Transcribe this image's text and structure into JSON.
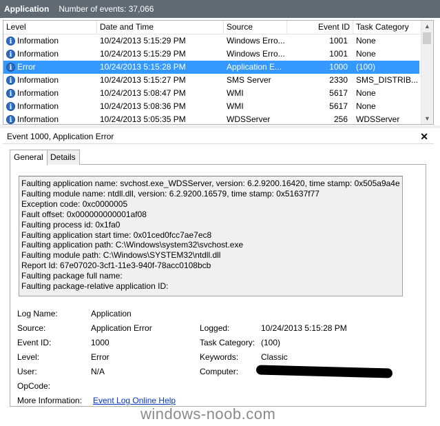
{
  "window": {
    "title": "Application",
    "count_text": "Number of events: 37,066"
  },
  "columns": [
    "Level",
    "Date and Time",
    "Source",
    "Event ID",
    "Task Category"
  ],
  "events": [
    {
      "level": "Information",
      "date": "10/24/2013 5:15:29 PM",
      "source": "Windows Erro...",
      "id": "1001",
      "task": "None",
      "selected": false
    },
    {
      "level": "Information",
      "date": "10/24/2013 5:15:29 PM",
      "source": "Windows Erro...",
      "id": "1001",
      "task": "None",
      "selected": false
    },
    {
      "level": "Error",
      "date": "10/24/2013 5:15:28 PM",
      "source": "Application E...",
      "id": "1000",
      "task": "(100)",
      "selected": true
    },
    {
      "level": "Information",
      "date": "10/24/2013 5:15:27 PM",
      "source": "SMS Server",
      "id": "2330",
      "task": "SMS_DISTRIB...",
      "selected": false
    },
    {
      "level": "Information",
      "date": "10/24/2013 5:08:47 PM",
      "source": "WMI",
      "id": "5617",
      "task": "None",
      "selected": false
    },
    {
      "level": "Information",
      "date": "10/24/2013 5:08:36 PM",
      "source": "WMI",
      "id": "5617",
      "task": "None",
      "selected": false
    },
    {
      "level": "Information",
      "date": "10/24/2013 5:05:35 PM",
      "source": "WDSServer",
      "id": "256",
      "task": "WDSServer",
      "selected": false
    }
  ],
  "detail": {
    "title": "Event 1000, Application Error",
    "tabs": [
      "General",
      "Details"
    ],
    "description": [
      "Faulting application name: svchost.exe_WDSServer, version: 6.2.9200.16420, time stamp: 0x505a9a4e",
      "Faulting module name: ntdll.dll, version: 6.2.9200.16579, time stamp: 0x51637f77",
      "Exception code: 0xc0000005",
      "Fault offset: 0x000000000001af08",
      "Faulting process id: 0x1fa0",
      "Faulting application start time: 0x01ced0fcc7ae7ec8",
      "Faulting application path: C:\\Windows\\system32\\svchost.exe",
      "Faulting module path: C:\\Windows\\SYSTEM32\\ntdll.dll",
      "Report Id: 67e07020-3cf1-11e3-940f-78acc0108bcb",
      "Faulting package full name:",
      "Faulting package-relative application ID:"
    ],
    "fields": {
      "log_name_label": "Log Name:",
      "log_name": "Application",
      "source_label": "Source:",
      "source": "Application Error",
      "logged_label": "Logged:",
      "logged": "10/24/2013 5:15:28 PM",
      "event_id_label": "Event ID:",
      "event_id": "1000",
      "task_label": "Task Category:",
      "task": "(100)",
      "level_label": "Level:",
      "level": "Error",
      "keywords_label": "Keywords:",
      "keywords": "Classic",
      "user_label": "User:",
      "user": "N/A",
      "computer_label": "Computer:",
      "opcode_label": "OpCode:",
      "more_info_label": "More Information:",
      "more_info_link": "Event Log Online Help"
    }
  },
  "watermark": "windows-noob.com"
}
